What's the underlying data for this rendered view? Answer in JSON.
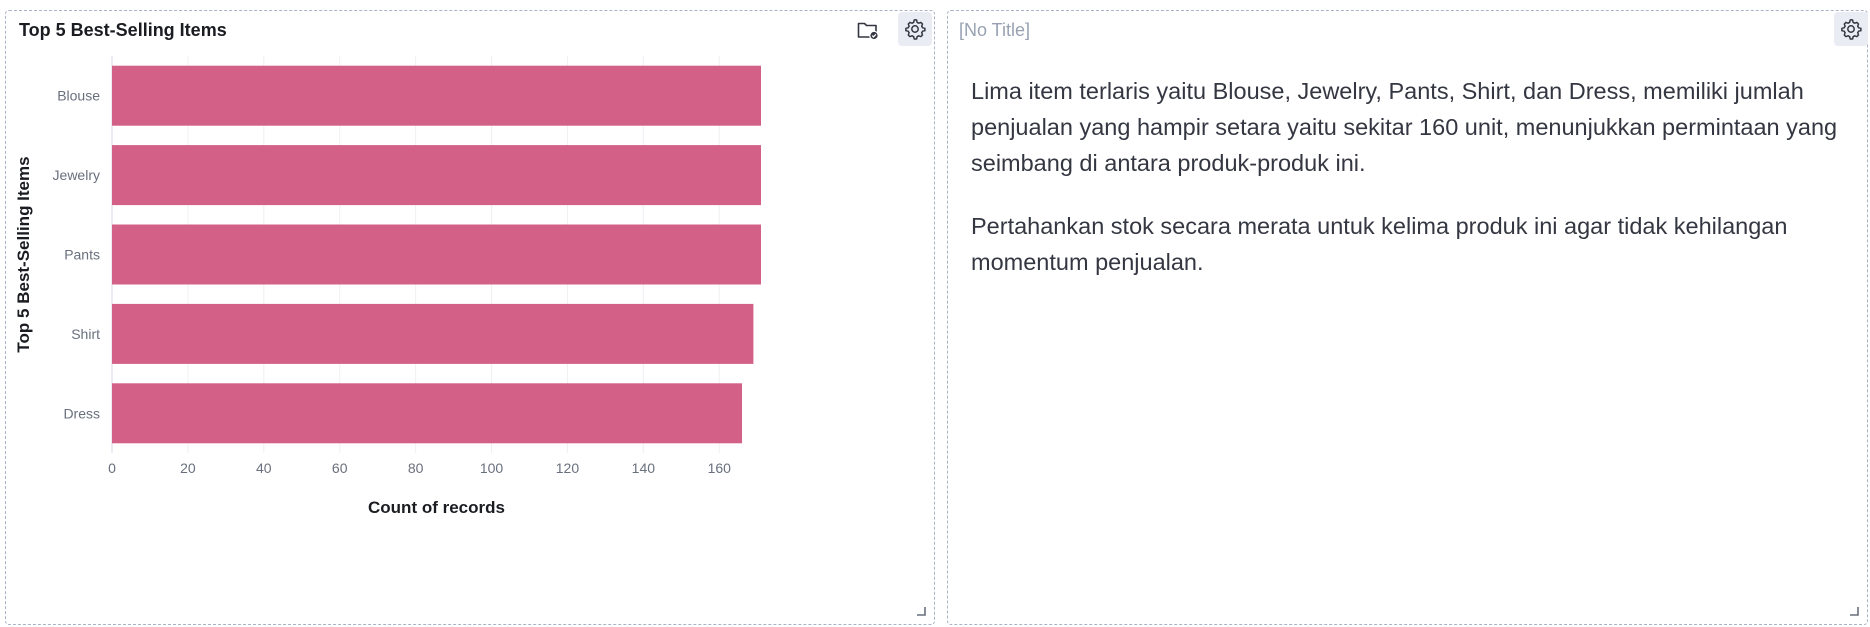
{
  "chart_panel": {
    "title": "Top 5 Best-Selling Items"
  },
  "text_panel": {
    "title": "[No Title]",
    "paragraphs": [
      "Lima item terlaris yaitu Blouse, Jewelry, Pants, Shirt, dan Dress, memiliki jumlah penjualan yang hampir setara yaitu sekitar 160 unit, menunjukkan permintaan yang seimbang di antara produk-produk ini.",
      "Pertahankan stok secara merata untuk kelima produk ini agar tidak kehilangan momentum penjualan."
    ]
  },
  "icons": {
    "folder": "folder-check-icon",
    "gear": "gear-icon",
    "resize": "resize-handle-icon"
  },
  "colors": {
    "bar": "#d36086",
    "grid": "#eef0f4",
    "axis_text": "#69707d",
    "title_text": "#1a1c21"
  },
  "chart_data": {
    "type": "bar",
    "orientation": "horizontal",
    "categories": [
      "Blouse",
      "Jewelry",
      "Pants",
      "Shirt",
      "Dress"
    ],
    "values": [
      172,
      172,
      172,
      169,
      166
    ],
    "xlabel": "Count of records",
    "ylabel": "Top 5 Best-Selling Items",
    "xlim": [
      0,
      171
    ],
    "xticks": [
      0,
      20,
      40,
      60,
      80,
      100,
      120,
      140,
      160
    ],
    "grid": true,
    "legend": "none"
  }
}
